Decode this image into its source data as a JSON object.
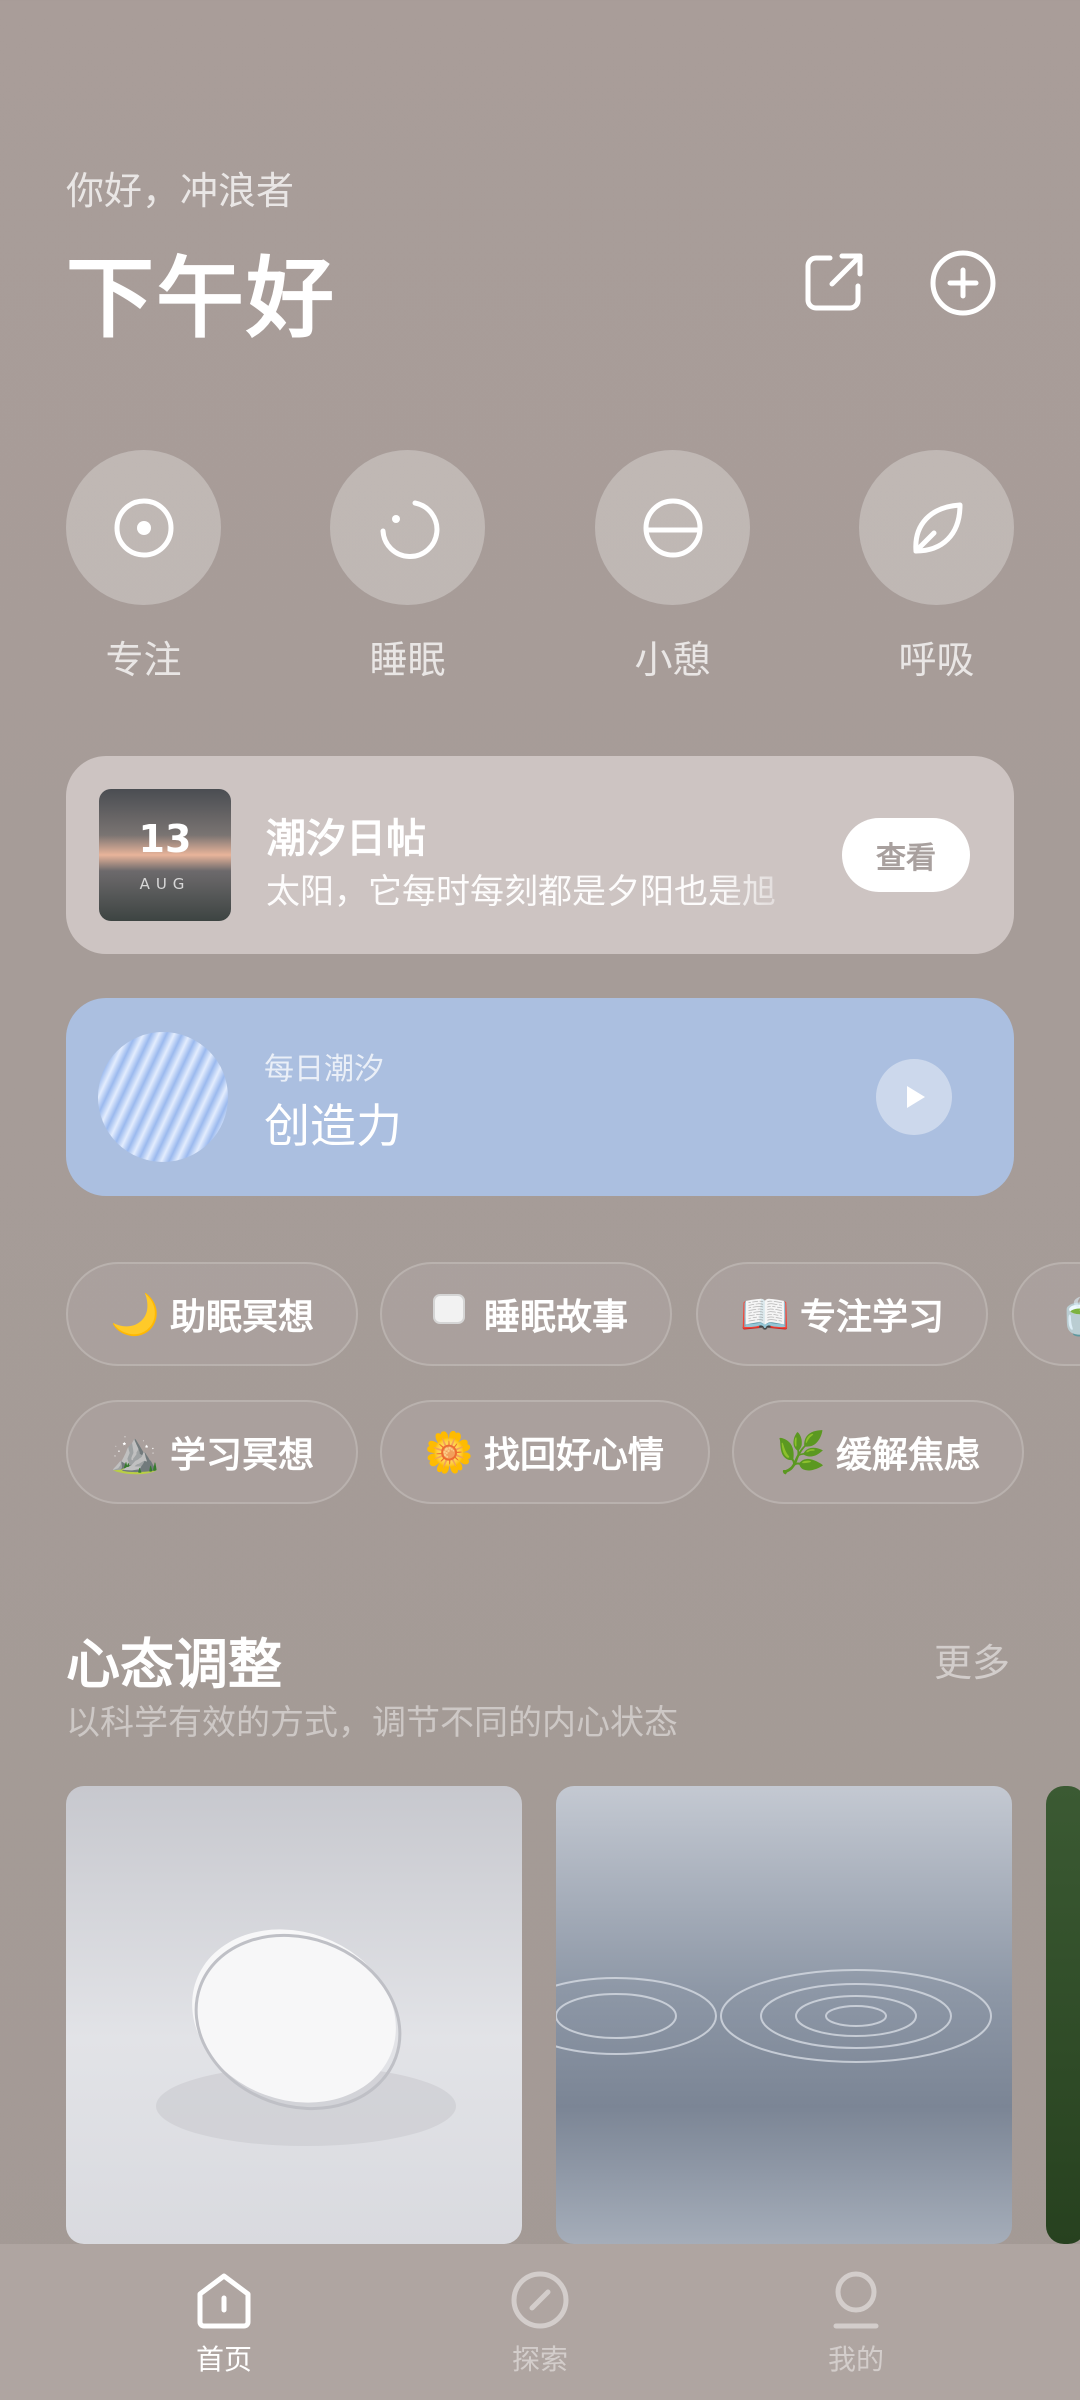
{
  "header": {
    "greeting": "你好，冲浪者",
    "title": "下午好"
  },
  "modes": [
    {
      "label": "专注",
      "icon": "focus-target-icon"
    },
    {
      "label": "睡眠",
      "icon": "moon-icon"
    },
    {
      "label": "小憩",
      "icon": "half-circle-icon"
    },
    {
      "label": "呼吸",
      "icon": "leaf-icon"
    }
  ],
  "diary": {
    "day": "13",
    "month": "AUG",
    "title": "潮汐日帖",
    "text": "太阳，它每时每刻都是夕阳也是旭",
    "button": "查看"
  },
  "daily": {
    "subtitle": "每日潮汐",
    "name": "创造力"
  },
  "tags": {
    "row1": [
      {
        "emoji": "🌙",
        "label": "助眠冥想"
      },
      {
        "emoji": "💤",
        "label": "睡眠故事"
      },
      {
        "emoji": "📖",
        "label": "专注学习"
      }
    ],
    "row2": [
      {
        "emoji": "⛰️",
        "label": "学习冥想"
      },
      {
        "emoji": "🌼",
        "label": "找回好心情"
      },
      {
        "emoji": "🌿",
        "label": "缓解焦虑"
      }
    ]
  },
  "section": {
    "title": "心态调整",
    "subtitle": "以科学有效的方式，调节不同的内心状态",
    "more": "更多"
  },
  "tabbar": [
    {
      "label": "首页",
      "active": true
    },
    {
      "label": "探索",
      "active": false
    },
    {
      "label": "我的",
      "active": false
    }
  ],
  "colors": {
    "background": "#a99d99",
    "diary_card": "#cdc4c2",
    "daily_card": "#abbfe0",
    "tabbar": "#afa5a1"
  }
}
